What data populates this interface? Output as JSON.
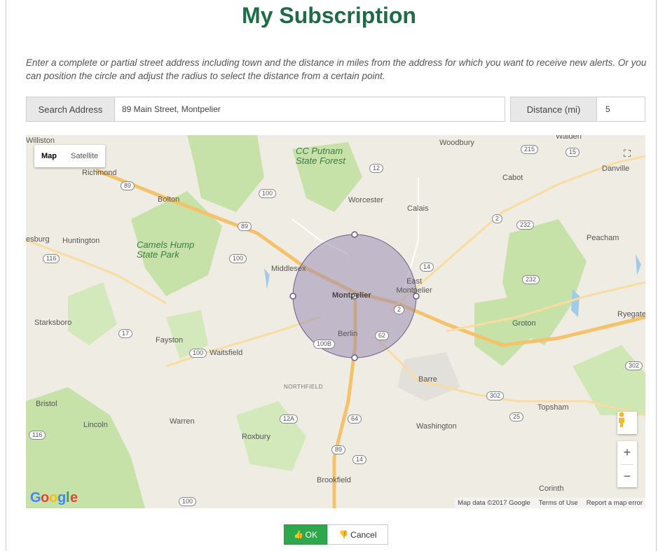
{
  "page": {
    "title": "My Subscription",
    "intro": "Enter a complete or partial street address including town and the distance in miles from the address for which you want to receive new alerts. Or you can position the circle and adjust the radius to select the distance from a certain point."
  },
  "form": {
    "address_label": "Search Address",
    "address_value": "89 Main Street, Montpelier",
    "distance_label": "Distance (mi)",
    "distance_value": "5"
  },
  "map": {
    "type_map": "Map",
    "type_satellite": "Satellite",
    "logo": "Google",
    "attribution": {
      "data": "Map data ©2017 Google",
      "terms": "Terms of Use",
      "report": "Report a map error"
    },
    "zoom_in": "+",
    "zoom_out": "−",
    "places": {
      "williston": "Williston",
      "richmond": "Richmond",
      "bolton": "Bolton",
      "huntington": "Huntington",
      "camels_hump": "Camels Hump State Park",
      "starksboro": "Starksboro",
      "fayston": "Fayston",
      "waitsfield": "Waitsfield",
      "bristol": "Bristol",
      "lincoln": "Lincoln",
      "warren": "Warren",
      "roxbury": "Roxbury",
      "northfield": "NORTHFIELD",
      "brookfield": "Brookfield",
      "cc_putnam": "CC Putnam State Forest",
      "worcester": "Worcester",
      "middlesex": "Middlesex",
      "montpelier": "Montpelier",
      "east_montpelier": "East Montpelier",
      "berlin": "Berlin",
      "calais": "Calais",
      "woodbury": "Woodbury",
      "cabot": "Cabot",
      "danville": "Danville",
      "walden": "Walden",
      "peacham": "Peacham",
      "groton": "Groton",
      "ryegate": "Ryegate",
      "barre": "Barre",
      "topsham": "Topsham",
      "washington": "Washington",
      "corinth": "Corinth",
      "esburg": "esburg"
    },
    "routes": [
      "89",
      "100",
      "116",
      "17",
      "12",
      "14",
      "2",
      "232",
      "215",
      "15",
      "302",
      "25",
      "12A",
      "64",
      "62",
      "100B"
    ]
  },
  "actions": {
    "ok": "OK",
    "cancel": "Cancel"
  },
  "colors": {
    "title": "#1f6b47",
    "ok_button": "#2ea84d",
    "circle_fill": "#9b8fb5"
  }
}
